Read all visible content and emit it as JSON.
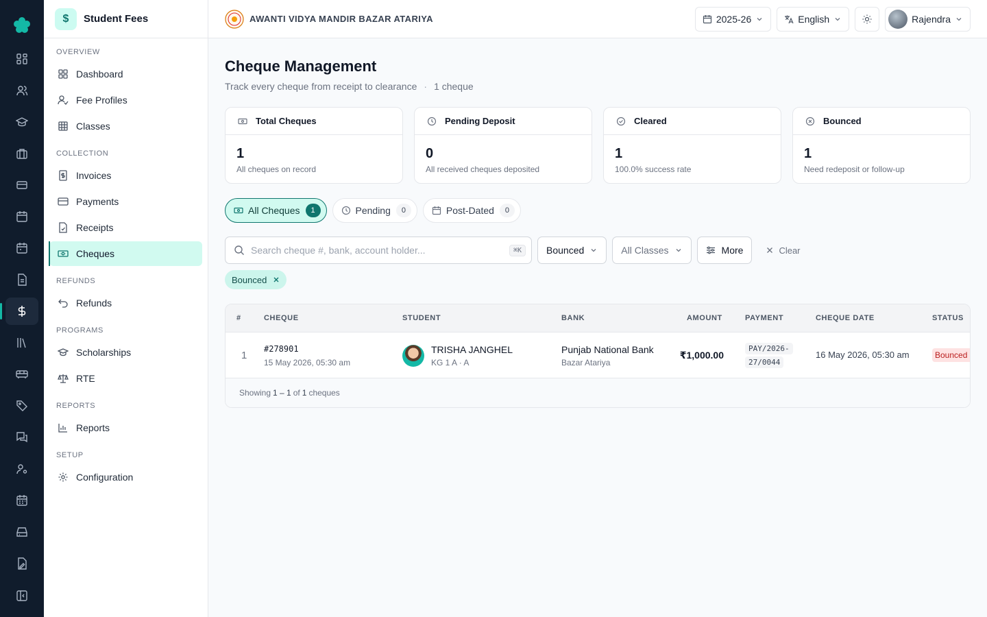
{
  "sidebar": {
    "title": "Student Fees",
    "sections": [
      {
        "title": "OVERVIEW",
        "items": [
          "Dashboard",
          "Fee Profiles",
          "Classes"
        ]
      },
      {
        "title": "COLLECTION",
        "items": [
          "Invoices",
          "Payments",
          "Receipts",
          "Cheques"
        ]
      },
      {
        "title": "REFUNDS",
        "items": [
          "Refunds"
        ]
      },
      {
        "title": "PROGRAMS",
        "items": [
          "Scholarships",
          "RTE"
        ]
      },
      {
        "title": "REPORTS",
        "items": [
          "Reports"
        ]
      },
      {
        "title": "SETUP",
        "items": [
          "Configuration"
        ]
      }
    ],
    "active_item": "Cheques"
  },
  "topbar": {
    "school_name": "AWANTI VIDYA MANDIR BAZAR ATARIYA",
    "session": "2025-26",
    "language": "English",
    "user": "Rajendra"
  },
  "page": {
    "title": "Cheque Management",
    "subtitle": "Track every cheque from receipt to clearance",
    "count_label": "1 cheque"
  },
  "stats": [
    {
      "label": "Total Cheques",
      "value": "1",
      "desc": "All cheques on record",
      "icon": "banknote-icon"
    },
    {
      "label": "Pending Deposit",
      "value": "0",
      "desc": "All received cheques deposited",
      "icon": "clock-icon"
    },
    {
      "label": "Cleared",
      "value": "1",
      "desc": "100.0% success rate",
      "icon": "check-circle-icon"
    },
    {
      "label": "Bounced",
      "value": "1",
      "desc": "Need redeposit or follow-up",
      "icon": "x-circle-icon"
    }
  ],
  "tabs": [
    {
      "label": "All Cheques",
      "count": "1",
      "active": true
    },
    {
      "label": "Pending",
      "count": "0",
      "active": false
    },
    {
      "label": "Post-Dated",
      "count": "0",
      "active": false
    }
  ],
  "filters": {
    "search_placeholder": "Search cheque #, bank, account holder...",
    "search_shortcut": "⌘K",
    "status": "Bounced",
    "classes": "All Classes",
    "more": "More",
    "clear": "Clear",
    "active_chips": [
      "Bounced"
    ]
  },
  "table": {
    "columns": [
      "#",
      "CHEQUE",
      "STUDENT",
      "BANK",
      "AMOUNT",
      "PAYMENT",
      "CHEQUE DATE",
      "STATUS"
    ],
    "rows": [
      {
        "index": "1",
        "cheque_no": "#278901",
        "cheque_received": "15 May 2026, 05:30 am",
        "student_name": "TRISHA JANGHEL",
        "student_class": "KG 1 A · A",
        "bank": "Punjab National Bank",
        "branch": "Bazar Atariya",
        "amount": "₹1,000.00",
        "payment_ref": "PAY/2026-27/0044",
        "cheque_date": "16 May 2026, 05:30 am",
        "status": "Bounced"
      }
    ],
    "footer": {
      "prefix": "Showing",
      "range": "1 – 1",
      "of": "of",
      "total": "1",
      "suffix": "cheques"
    }
  },
  "colors": {
    "accent": "#0f766e",
    "accent_light": "#d1faf0",
    "rail_bg": "#101c2c",
    "bounced_bg": "#fee2e2",
    "bounced_text": "#b91c1c"
  }
}
